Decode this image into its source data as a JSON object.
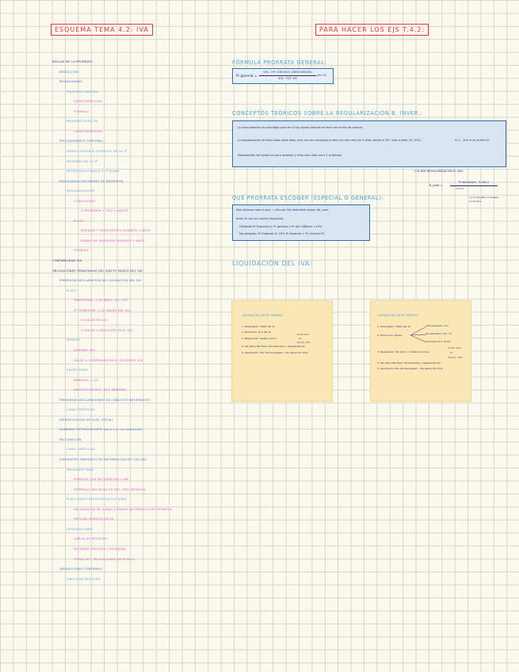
{
  "titles": {
    "left": "ESQUEMA TEMA 4.2: IVA",
    "right": "PARA HACER LOS EJS T.4.2:"
  },
  "outline": [
    {
      "text": "REGLAS DE LA PRORRATA",
      "level": 0,
      "color": "navy"
    },
    {
      "text": "DEDUCCIÓN",
      "level": 1,
      "color": "blue"
    },
    {
      "text": "MODALIDADES",
      "level": 1,
      "color": "blue"
    },
    {
      "text": "PRORRATA GENERAL",
      "level": 2,
      "color": "lblue"
    },
    {
      "text": "CARACTERÍSTICAS",
      "level": 3,
      "color": "pink"
    },
    {
      "text": "FÓRMULA",
      "level": 3,
      "color": "pink"
    },
    {
      "text": "PRORRATA ESPECIAL",
      "level": 2,
      "color": "lblue"
    },
    {
      "text": "CARACTERÍSTICAS",
      "level": 3,
      "color": "pink"
    },
    {
      "text": "PROCEDIMIENTO TEMPORAL",
      "level": 1,
      "color": "blue"
    },
    {
      "text": "DEDUCCIÓN EN EL EJERCICIO DE LA 1ª",
      "level": 2,
      "color": "lblue"
    },
    {
      "text": "PRORRATA EN LA 1ª",
      "level": 2,
      "color": "lblue"
    },
    {
      "text": "DEFINITIVA en base a + 1ª ajuste",
      "level": 2,
      "color": "lblue"
    },
    {
      "text": "REGULARIZACIÓN BIENES DE INVERSIÓN",
      "level": 1,
      "color": "blue"
    },
    {
      "text": "REGULARIZACIÓN",
      "level": 2,
      "color": "lblue"
    },
    {
      "text": "CONDICIONES",
      "level": 3,
      "color": "pink"
    },
    {
      "text": "% PRORRATA > 10% + AJUSTE",
      "level": 4,
      "color": "pink"
    },
    {
      "text": "PLAZO",
      "level": 3,
      "color": "pink"
    },
    {
      "text": "MUEBLES Y SEMOVIENTES DURANTE 4 AÑOS",
      "level": 4,
      "color": "pink"
    },
    {
      "text": "BIENES DE INVERSIÓN DURANTE 9 AÑOS",
      "level": 4,
      "color": "pink"
    },
    {
      "text": "FÓRMULA",
      "level": 3,
      "color": "pink"
    },
    {
      "text": "CONTABILIDAD IVA",
      "level": 0,
      "color": "navy"
    },
    {
      "text": "OBLIGACIONES TRIBUTARIAS DEL SUJETO PASIVO DEL IVA",
      "level": 0,
      "color": "navy"
    },
    {
      "text": "PRESENTAR DECLARACIÓN DE LIQUIDACIÓN DEL IVA",
      "level": 1,
      "color": "blue"
    },
    {
      "text": "PLAZO",
      "level": 2,
      "color": "lblue"
    },
    {
      "text": "TRIMESTRAL: 1-20 ABRIL, JUL, OCT",
      "level": 3,
      "color": "pink"
    },
    {
      "text": "4º TRIMESTRE: 1-30 ENERO DEL SIG.",
      "level": 3,
      "color": "pink"
    },
    {
      "text": "SI SALDO ES A 0:",
      "level": 4,
      "color": "pink"
    },
    {
      "text": "SI SALDO A DEVOLVER EN EL SIG.",
      "level": 4,
      "color": "pink"
    },
    {
      "text": "MODELO",
      "level": 2,
      "color": "lblue"
    },
    {
      "text": "GENERAL 303",
      "level": 3,
      "color": "pink"
    },
    {
      "text": "SALDO A COMPENSAR EN EL SIGUIENTE 303",
      "level": 3,
      "color": "pink"
    },
    {
      "text": "EXCEPCIONES",
      "level": 2,
      "color": "lblue"
    },
    {
      "text": "MENSUAL: 1-20",
      "level": 3,
      "color": "pink"
    },
    {
      "text": "INSCRITO EN REG. DEV. MENSUAL",
      "level": 3,
      "color": "pink"
    },
    {
      "text": "PRESENTAR DECLARACIONES DE CARÁCTER INFORMATIVO",
      "level": 1,
      "color": "blue"
    },
    {
      "text": "CARACTERÍSTICAS",
      "level": 2,
      "color": "lblue"
    },
    {
      "text": "IDENTIFICACIÓN (Nº ALTA, FISCAL)",
      "level": 1,
      "color": "blue"
    },
    {
      "text": "NOMBRAR REPRESENTANTE (para e.g. no residentes)",
      "level": 1,
      "color": "blue"
    },
    {
      "text": "FACTURACIÓN",
      "level": 1,
      "color": "blue"
    },
    {
      "text": "CARACTERÍSTICAS",
      "level": 2,
      "color": "lblue"
    },
    {
      "text": "SUMINISTRO INMEDIATO DE INFORMACIÓN DEL IVA (SII)",
      "level": 1,
      "color": "blue"
    },
    {
      "text": "OBLIGADOS PARA",
      "level": 2,
      "color": "lblue"
    },
    {
      "text": "EMPRESA CON FACTURACIÓN > 6M",
      "level": 3,
      "color": "pink"
    },
    {
      "text": "EMPRESAS INSCRITAS EN REG. DEV. MENSUAL",
      "level": 3,
      "color": "pink"
    },
    {
      "text": "PLAZO ENVÍO REGISTRO DE FACTURAS",
      "level": 2,
      "color": "lblue"
    },
    {
      "text": "FACTURACIÓN DE 4 DÍAS A TRAVÉS DE MEDIOS ELECTRÓNICOS",
      "level": 3,
      "color": "pink"
    },
    {
      "text": "PRESTAR SERVICIO EN SII",
      "level": 3,
      "color": "pink"
    },
    {
      "text": "OBSERVACIONES",
      "level": 2,
      "color": "lblue"
    },
    {
      "text": "LIBROS DE REGISTRO",
      "level": 3,
      "color": "pink"
    },
    {
      "text": "FACTURAS EMITIDAS Y RECIBIDAS",
      "level": 3,
      "color": "pink"
    },
    {
      "text": "OTRAS REF. OBLIGACIONES DE PLAZOS",
      "level": 3,
      "color": "pink"
    },
    {
      "text": "OBLIGACIONES CONTABLES",
      "level": 1,
      "color": "blue"
    },
    {
      "text": "LIBROS DE REGISTRO",
      "level": 2,
      "color": "lblue"
    }
  ],
  "formula": {
    "heading": "FÓRMULA PRORRATA GENERAL:",
    "lhs": "Pr general =",
    "numerator": "VOL. OP. CON DCH. (DEDUCIBLES)",
    "denominator": "VOL. TOT. OP.",
    "suffix": "(en %)"
  },
  "concepts": {
    "heading": "CONCEPTOS TEÓRICOS SOBRE LA REGULARIZACIÓN B. INVER.:",
    "bullets": [
      "La comprobación de prorrataje para ver si hay ajuste siempre se hace con el año de compra.",
      "La regularización se hace todos estos años, sino una vez comprado el bien (en año cero) en 9 años, desde el 10º, más a partir 10, 20%...",
      "Demostrador del ajuste: es para muebles y tiene sino cada vez a 1 al tiempo."
    ],
    "side_note": "Pr 1 - 20% si es el año 10"
  },
  "regularization": {
    "label": "→ SI HAY REGULARIZACIÓN B. INV.:",
    "lhs": "R_prob =",
    "numerator": "Pr def.compra - Pr año n",
    "denominator": "5 ó 10",
    "note1": "5 ó 10 (muebles, inmuebles)",
    "note2": "5 ó 10 años"
  },
  "pregunta": {
    "heading": "QUÉ PRORRATA ESCOGER (ESPECIAL O GENERAL):",
    "line1": "Nos interesa más la que → cifra de IVA deducible mayor de, pero",
    "line2": "tener el uso en cuenta (especial):",
    "bullet1": "Obligado Pr Especial si: Pr general y Pr def. difieren >10%",
    "bullet2": "No obligado: Pr Especial si: 20% Pr Especial > Pr General Pr."
  },
  "liquidacion": {
    "heading": "LIQUIDACIÓN DEL IVA:",
    "general": {
      "title": "LIQUIDACIÓN CON PR. GENERAL:",
      "rows": [
        "1. Devengado: 1000/ del 12",
        "2. Deducible: Pr 1 del 12",
        "3. Regularizar: Ajustes (prov)",
        "4. IVA deducible final: IVA deducible + Regularización",
        "5. Liquidación: IVA: IVA devengado - IVA deducción final"
      ],
      "side": [
        "Pr def. 12.0",
        "13",
        "Pr prov. 13.0"
      ]
    },
    "especial": {
      "title": "LIQUIDACIÓN CON PR. ESPECIAL:",
      "rows": [
        "1. Devengado: 1000/ del 12",
        "2. Deducción: gastos",
        "3. Regularizar: IVA deduc.: Costes comunes",
        "4. IVA deducible final: IVA deducible + Regularización",
        "5. Liquidación IVA: IVA devengado - IVA deducción final"
      ],
      "branches": [
        "Deducibles-solo: 12.0",
        "No deducibles: 12.0 - 13",
        "Comunes: 12.0 - Pr def."
      ],
      "side": [
        "Pr def.: 12.0",
        "13",
        "Pr prov.: 13.0"
      ]
    }
  }
}
